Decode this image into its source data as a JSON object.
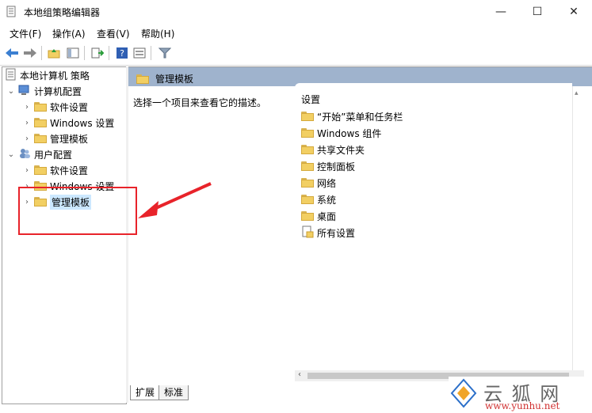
{
  "window": {
    "title": "本地组策略编辑器",
    "minimize_glyph": "—",
    "maximize_glyph": "☐",
    "close_glyph": "✕"
  },
  "menu": {
    "file": "文件(F)",
    "action": "操作(A)",
    "view": "查看(V)",
    "help": "帮助(H)"
  },
  "tree": {
    "root": "本地计算机 策略",
    "computer_config": "计算机配置",
    "computer_children": [
      "软件设置",
      "Windows 设置",
      "管理模板"
    ],
    "user_config": "用户配置",
    "user_children": [
      "软件设置",
      "Windows 设置",
      "管理模板"
    ]
  },
  "right": {
    "header_title": "管理模板",
    "description": "选择一个项目来查看它的描述。",
    "column_header": "设置",
    "items": [
      "“开始”菜单和任务栏",
      "Windows 组件",
      "共享文件夹",
      "控制面板",
      "网络",
      "系统",
      "桌面",
      "所有设置"
    ],
    "tabs": [
      "扩展",
      "标准"
    ]
  },
  "watermark": {
    "brand": "云 狐 网",
    "url": "www.yunhu.net"
  },
  "colors": {
    "header_band": "#9fb3cd",
    "selection": "#cce8ff",
    "annotation_red": "#e8232a",
    "folder": "#f2cf63"
  }
}
